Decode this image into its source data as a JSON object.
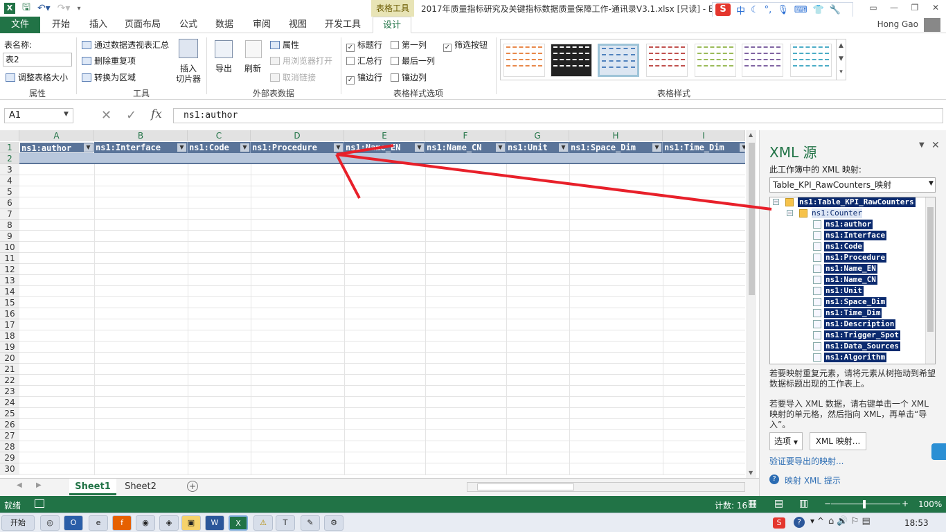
{
  "title_bar": {
    "context_tab": "表格工具",
    "document_title": "2017年质量指标研究及关键指标数据质量保障工作-通讯录V3.1.xlsx [只读] - E",
    "ime": {
      "logo": "S",
      "mode": "中"
    }
  },
  "tabs": [
    "文件",
    "开始",
    "插入",
    "页面布局",
    "公式",
    "数据",
    "审阅",
    "视图",
    "开发工具",
    "设计"
  ],
  "user": "Hong Gao",
  "ribbon": {
    "properties": {
      "table_name_label": "表名称:",
      "table_name": "表2",
      "resize": "调整表格大小",
      "group": "属性"
    },
    "tools": {
      "pivot": "通过数据透视表汇总",
      "remove_dup": "删除重复项",
      "convert": "转换为区域",
      "slicer1": "插入",
      "slicer2": "切片器",
      "group": "工具"
    },
    "external": {
      "export": "导出",
      "refresh": "刷新",
      "properties": "属性",
      "open_browser": "用浏览器打开",
      "unlink": "取消链接",
      "group": "外部表数据"
    },
    "style_options": {
      "header_row": "标题行",
      "total_row": "汇总行",
      "banded_rows": "镶边行",
      "first_col": "第一列",
      "last_col": "最后一列",
      "banded_cols": "镶边列",
      "filter_btn": "筛选按钮",
      "group": "表格样式选项"
    },
    "styles": {
      "group": "表格样式",
      "swatch_colors": [
        "#e8884a",
        "#222222",
        "#4f81bd",
        "#c0504d",
        "#9bbb59",
        "#8064a2",
        "#4bacc6"
      ]
    }
  },
  "formula_bar": {
    "name_box": "A1",
    "fx": "fx",
    "content": "ns1:author"
  },
  "grid": {
    "columns": [
      "A",
      "B",
      "C",
      "D",
      "E",
      "F",
      "G",
      "H",
      "I"
    ],
    "rows": [
      "1",
      "2",
      "3",
      "4",
      "5",
      "6",
      "7",
      "8",
      "9",
      "10",
      "11",
      "12",
      "13",
      "14",
      "15",
      "16",
      "17",
      "18",
      "19",
      "20",
      "21",
      "22",
      "23",
      "24",
      "25",
      "26",
      "27",
      "28",
      "29",
      "30"
    ],
    "header_cells": [
      "ns1:author",
      "ns1:Interface",
      "ns1:Code",
      "ns1:Procedure",
      "ns1:Name_EN",
      "ns1:Name_CN",
      "ns1:Unit",
      "ns1:Space_Dim",
      "ns1:Time_Dim"
    ]
  },
  "sheets": [
    "Sheet1",
    "Sheet2"
  ],
  "status": {
    "ready": "就绪",
    "count": "计数: 16",
    "zoom": "100%"
  },
  "xml_pane": {
    "title": "XML 源",
    "maps_label": "此工作簿中的 XML 映射:",
    "map_selected": "Table_KPI_RawCounters_映射",
    "root": "ns1:Table_KPI_RawCounters",
    "counter": "ns1:Counter",
    "elements": [
      "ns1:author",
      "ns1:Interface",
      "ns1:Code",
      "ns1:Procedure",
      "ns1:Name_EN",
      "ns1:Name_CN",
      "ns1:Unit",
      "ns1:Space_Dim",
      "ns1:Time_Dim",
      "ns1:Description",
      "ns1:Trigger_Spot",
      "ns1:Data_Sources",
      "ns1:Algorithm"
    ],
    "help1": "若要映射重复元素，请将元素从树拖动到希望数据标题出现的工作表上。",
    "help2": "若要导入 XML 数据，请右键单击一个 XML 映射的单元格，然后指向 XML，再单击“导入”。",
    "options_btn": "选项",
    "xml_map_btn": "XML 映射...",
    "verify_link": "验证要导出的映射...",
    "help_link": "映射 XML 提示"
  },
  "taskbar": {
    "start": "开始",
    "clock": "18:53"
  }
}
